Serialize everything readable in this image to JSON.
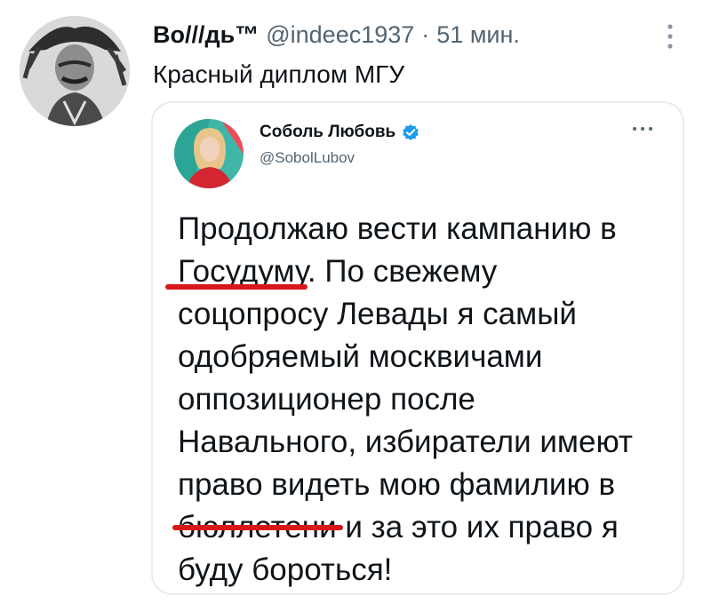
{
  "tweet": {
    "author_name": "Во///дь™",
    "author_handle": "@indeec1937",
    "separator": "·",
    "time": "51 мин.",
    "text": "Красный диплом МГУ"
  },
  "quoted": {
    "author_name": "Соболь Любовь",
    "author_handle": "@SobolLubov",
    "verified": true,
    "body_lines": [
      "Продолжаю вести кампанию в",
      "Госудуму. По свежему",
      "соцопросу Левады я самый",
      "одобряемый москвичами",
      "оппозиционер после",
      "Навального, избиратели имеют",
      "право видеть мою фамилию в",
      "бюллетени и за это их право я",
      "буду бороться!"
    ]
  },
  "annotations": {
    "underlined_words": [
      "Госудуму",
      "бюллетени"
    ],
    "underline_color": "#d8161b"
  },
  "icons": {
    "top_more": "more-vertical-icon",
    "quote_more": "more-horizontal-icon",
    "verified": "verified-badge-icon"
  },
  "colors": {
    "text": "#0f1419",
    "secondary": "#536471",
    "verified_blue": "#1d9bf0",
    "card_border": "#e7ecf0"
  }
}
